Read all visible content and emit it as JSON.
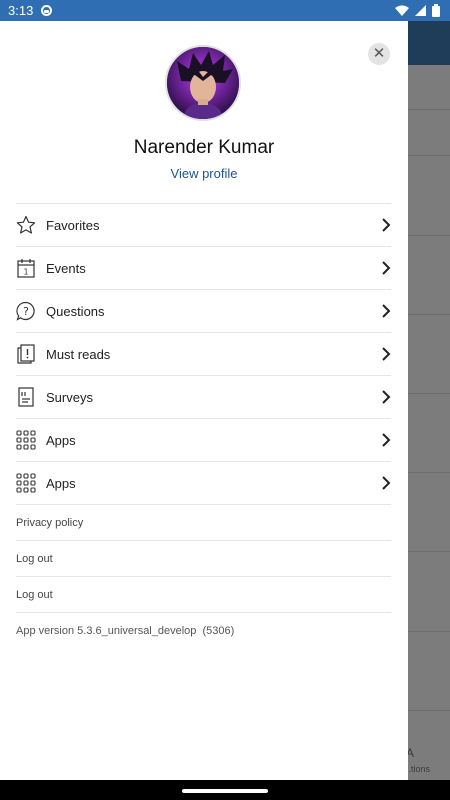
{
  "status_bar": {
    "time": "3:13"
  },
  "profile": {
    "name": "Narender Kumar",
    "view_profile_label": "View profile"
  },
  "menu": [
    {
      "label": "Favorites",
      "icon": "star-icon"
    },
    {
      "label": "Events",
      "icon": "calendar-icon"
    },
    {
      "label": "Questions",
      "icon": "question-bubble-icon"
    },
    {
      "label": "Must reads",
      "icon": "must-read-icon"
    },
    {
      "label": "Surveys",
      "icon": "survey-icon"
    },
    {
      "label": "Apps",
      "icon": "apps-grid-icon"
    },
    {
      "label": "Apps",
      "icon": "apps-grid-icon"
    }
  ],
  "links": [
    {
      "label": "Privacy policy"
    },
    {
      "label": "Log out"
    },
    {
      "label": "Log out"
    }
  ],
  "app_version": "App version 5.3.6_universal_develop  (5306)",
  "background": {
    "bottom_label": "...tions"
  }
}
